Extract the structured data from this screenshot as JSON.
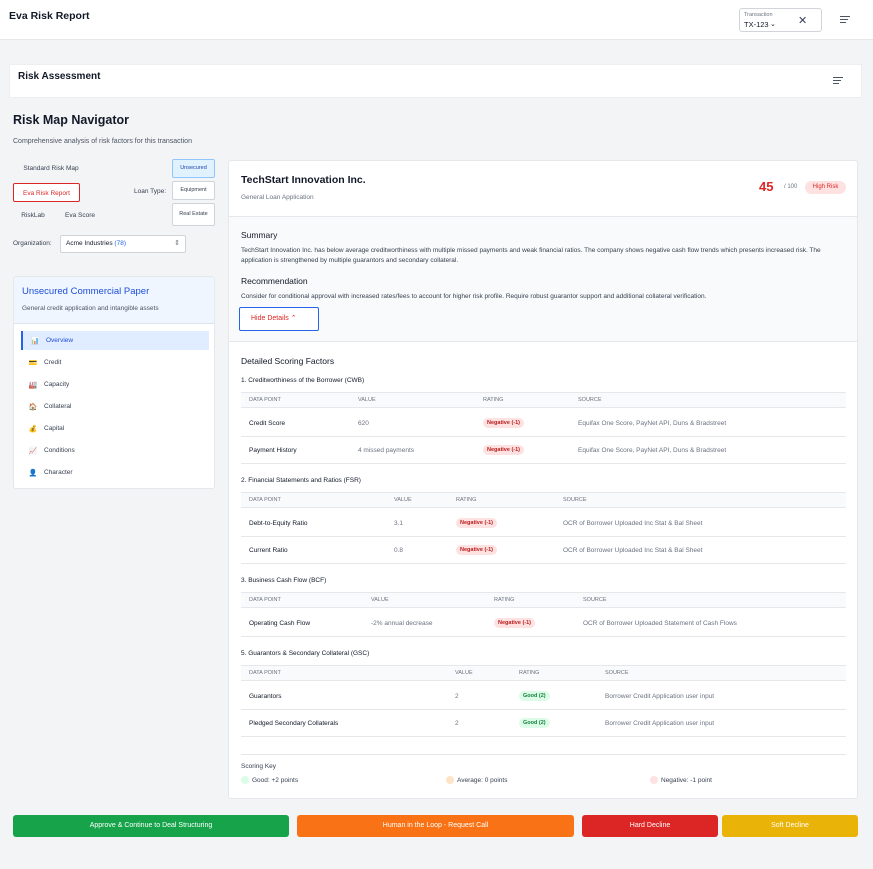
{
  "header": {
    "title": "Eva Risk Report",
    "transaction_label": "Transaction",
    "transaction_value": "TX-123"
  },
  "risk_assessment": {
    "title": "Risk Assessment"
  },
  "navigator": {
    "title": "Risk Map Navigator",
    "subtitle": "Comprehensive analysis of risk factors for this transaction",
    "tabs": [
      "Standard Risk Map",
      "Eva Risk Report",
      "RiskLab",
      "Eva Score"
    ],
    "loan_type_label": "Loan Type:",
    "loan_types": [
      "Unsecured",
      "Equipment",
      "Real Estate"
    ],
    "org_label": "Organization:",
    "org_value": "Acme Industries",
    "org_count": "(78)"
  },
  "side": {
    "title": "Unsecured Commercial Paper",
    "subtitle": "General credit application and intangible assets",
    "items": [
      {
        "label": "Overview",
        "icon": "bar-chart-icon"
      },
      {
        "label": "Credit",
        "icon": "credit-card-icon"
      },
      {
        "label": "Capacity",
        "icon": "factory-icon"
      },
      {
        "label": "Collateral",
        "icon": "house-icon"
      },
      {
        "label": "Capital",
        "icon": "money-bag-icon"
      },
      {
        "label": "Conditions",
        "icon": "trend-chart-icon"
      },
      {
        "label": "Character",
        "icon": "person-icon"
      }
    ]
  },
  "main": {
    "company": "TechStart Innovation Inc.",
    "company_sub": "General Loan Application",
    "score": "45",
    "score_max": "/ 100",
    "risk_label": "High Risk",
    "summary_title": "Summary",
    "summary_text": "TechStart Innovation Inc. has below average creditworthiness with multiple missed payments and weak financial ratios. The company shows negative cash flow trends which presents increased risk. The application is strengthened by multiple guarantors and secondary collateral.",
    "recommendation_title": "Recommendation",
    "recommendation_text": "Consider for conditional approval with increased rates/fees to account for higher risk profile. Require robust guarantor support and additional collateral verification.",
    "hide_details": "Hide Details",
    "dsf_title": "Detailed Scoring Factors",
    "col_headers": [
      "DATA POINT",
      "VALUE",
      "RATING",
      "SOURCE"
    ],
    "groups": [
      {
        "title": "1. Creditworthiness of the Borrower (CWB)",
        "rows": [
          {
            "point": "Credit Score",
            "value": "620",
            "rating": "Negative (-1)",
            "source": "Equifax One Score, PayNet API, Duns & Bradstreet"
          },
          {
            "point": "Payment History",
            "value": "4 missed payments",
            "rating": "Negative (-1)",
            "source": "Equifax One Score, PayNet API, Duns & Bradstreet"
          }
        ]
      },
      {
        "title": "2. Financial Statements and Ratios (FSR)",
        "rows": [
          {
            "point": "Debt-to-Equity Ratio",
            "value": "3.1",
            "rating": "Negative (-1)",
            "source": "OCR of Borrower Uploaded Inc Stat & Bal Sheet"
          },
          {
            "point": "Current Ratio",
            "value": "0.8",
            "rating": "Negative (-1)",
            "source": "OCR of Borrower Uploaded Inc Stat & Bal Sheet"
          }
        ]
      },
      {
        "title": "3. Business Cash Flow (BCF)",
        "rows": [
          {
            "point": "Operating Cash Flow",
            "value": "-2% annual decrease",
            "rating": "Negative (-1)",
            "source": "OCR of Borrower Uploaded Statement of Cash Flows"
          }
        ]
      },
      {
        "title": "5. Guarantors & Secondary Collateral (GSC)",
        "rows": [
          {
            "point": "Guarantors",
            "value": "2",
            "rating": "Good (2)",
            "source": "Borrower Credit Application user input"
          },
          {
            "point": "Pledged Secondary Collaterals",
            "value": "2",
            "rating": "Good (2)",
            "source": "Borrower Credit Application user input"
          }
        ]
      }
    ],
    "scoring_key_title": "Scoring Key",
    "key_good": "Good: +2 points",
    "key_average": "Average: 0 points",
    "key_negative": "Negative: -1 point"
  },
  "actions": {
    "approve": "Approve & Continue to Deal Structuring",
    "human": "Human in the Loop - Request Call",
    "hard": "Hard Decline",
    "soft": "Soft Decline"
  },
  "colors": {
    "approve": "#16a34a",
    "human": "#f97316",
    "hard": "#dc2626",
    "soft": "#eab308",
    "accent": "#2563eb",
    "danger": "#dc2626"
  }
}
